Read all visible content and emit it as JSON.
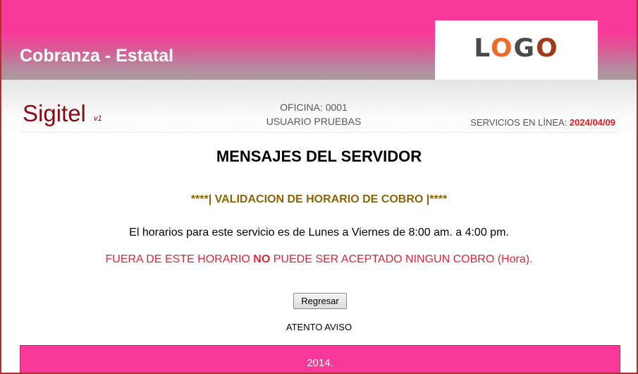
{
  "header": {
    "title": "Cobranza - Estatal",
    "logo": {
      "letters": [
        "L",
        "O",
        "G",
        "O"
      ],
      "colors": [
        "#4a4a4a",
        "#f06a2a",
        "#4a4a4a",
        "#a03a1a"
      ]
    },
    "accent_color": "#f9399a"
  },
  "subheader": {
    "brand": "Sigitel",
    "version": "v1",
    "office": "OFICINA: 0001",
    "user": "USUARIO PRUEBAS",
    "services_label": "SERVICIOS EN LÍNEA: ",
    "services_date": "2024/04/09"
  },
  "main": {
    "title": "MENSAJES DEL SERVIDOR",
    "validation": "****| VALIDACION DE HORARIO DE COBRO |****",
    "info": "El horarios para este servicio es de Lunes a Viernes de 8:00 am. a 4:00 pm.",
    "warning_pre": "FUERA DE ESTE HORARIO ",
    "warning_bold": "NO",
    "warning_post": " PUEDE SER ACEPTADO NINGUN COBRO (Hora).",
    "back_button": "Regresar",
    "notice": "ATENTO AVISO"
  },
  "footer": {
    "text": "2014."
  }
}
